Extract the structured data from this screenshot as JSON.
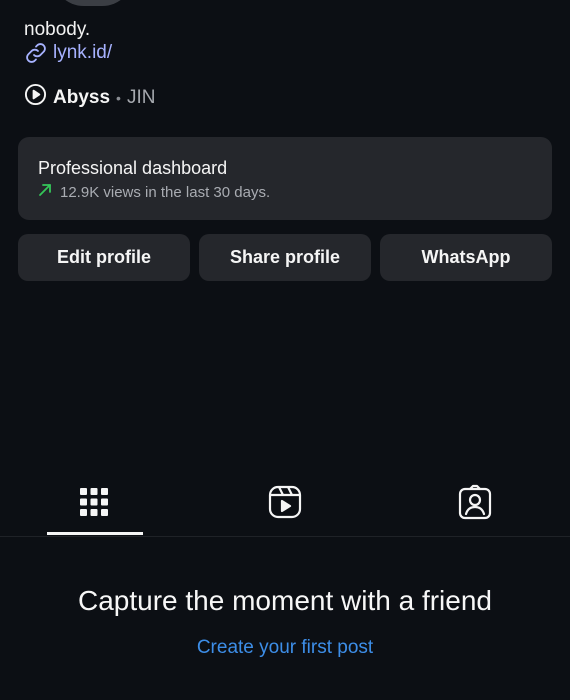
{
  "profile": {
    "bio_name": "nobody.",
    "link_text": "lynk.id/",
    "music": {
      "song": "Abyss",
      "separator": "•",
      "artist": "JIN"
    }
  },
  "dashboard": {
    "title": "Professional dashboard",
    "stat": "12.9K views in the last 30 days.",
    "trend_color": "#34c759"
  },
  "buttons": {
    "edit": "Edit profile",
    "share": "Share profile",
    "whatsapp": "WhatsApp"
  },
  "tabs": [
    {
      "icon": "grid-icon",
      "active": true
    },
    {
      "icon": "reels-icon",
      "active": false
    },
    {
      "icon": "tagged-icon",
      "active": false
    }
  ],
  "empty_state": {
    "heading": "Capture the moment with a friend",
    "link": "Create your first post"
  },
  "colors": {
    "background": "#0c0f14",
    "card": "#25272c",
    "link": "#a7b2ff",
    "action_link": "#3d8ee8"
  }
}
